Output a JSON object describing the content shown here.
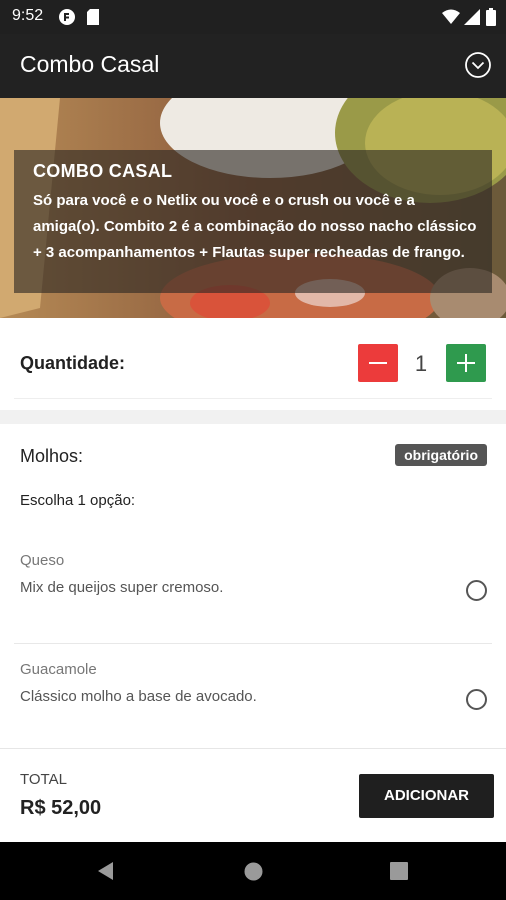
{
  "status_bar": {
    "time": "9:52"
  },
  "app_bar": {
    "title": "Combo Casal"
  },
  "hero": {
    "title": "COMBO CASAL",
    "description": "Só para você e o Netlix ou você e o crush ou você e a amiga(o). Combito 2 é a combinação do nosso nacho clássico + 3 acompanhamentos + Flautas super recheadas de frango."
  },
  "quantity": {
    "label": "Quantidade:",
    "value": "1"
  },
  "sauces": {
    "title": "Molhos:",
    "badge": "obrigatório",
    "instruction": "Escolha 1 opção:",
    "options": [
      {
        "name": "Queso",
        "description": "Mix de queijos super cremoso."
      },
      {
        "name": "Guacamole",
        "description": "Clássico molho a base de avocado."
      }
    ]
  },
  "footer": {
    "total_label": "TOTAL",
    "total_value": "R$ 52,00",
    "add_label": "ADICIONAR"
  },
  "colors": {
    "minus": "#ec3b3b",
    "plus": "#2f9a4e",
    "app_bar": "#222222",
    "add_button": "#1f1f1f"
  }
}
